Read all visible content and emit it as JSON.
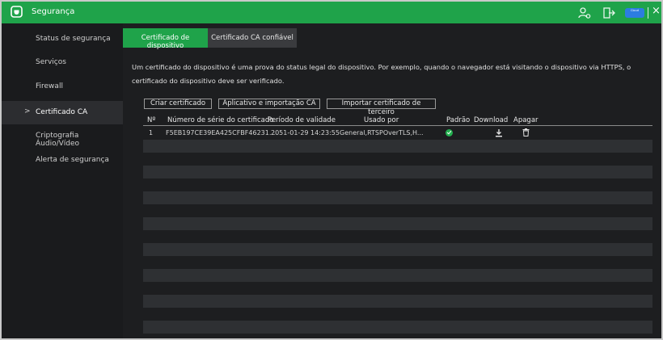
{
  "window": {
    "title": "Segurança",
    "close_glyph": "×"
  },
  "cloud_badge": "Cloud",
  "icons": {
    "app": "shield-icon",
    "user": "user-settings-icon",
    "logout": "logout-icon",
    "cloud": "cloud-icon",
    "close": "close-icon",
    "default": "check-circle-icon",
    "download": "download-icon",
    "delete": "trash-icon"
  },
  "colors": {
    "accent": "#1fa34a",
    "background": "#1d1e20",
    "row_alt": "#2e3033"
  },
  "sidebar": {
    "items": [
      {
        "label": "Status de segurança"
      },
      {
        "label": "Serviços"
      },
      {
        "label": "Firewall"
      },
      {
        "label": "Certificado CA",
        "active": true,
        "chevron": ">"
      },
      {
        "label": "Criptografia Áudio/Vídeo"
      },
      {
        "label": "Alerta de segurança"
      }
    ]
  },
  "tabs": [
    {
      "label": "Certificado de dispositivo",
      "active": true
    },
    {
      "label": "Certificado CA confiável",
      "active": false
    }
  ],
  "description": "Um certificado do dispositivo é uma prova do status legal do dispositivo. Por exemplo, quando o navegador está visitando o dispositivo via HTTPS, o certificado do dispositivo deve ser verificado.",
  "buttons": {
    "create": "Criar certificado",
    "import_ca": "Aplicativo e importação CA",
    "import_third": "Importar certificado de terceiro"
  },
  "table": {
    "headers": {
      "no": "Nº",
      "serial": "Número de série do certificado",
      "validity": "Período de validade",
      "used_by": "Usado por",
      "default": "Padrão",
      "download": "Download",
      "delete": "Apagar"
    },
    "rows": [
      {
        "no": "1",
        "serial": "F5EB197CE39EA425CFBF46231...",
        "validity": "2051-01-29 14:23:55",
        "used_by": "General,RTSPOverTLS,H...",
        "default": true
      }
    ]
  }
}
